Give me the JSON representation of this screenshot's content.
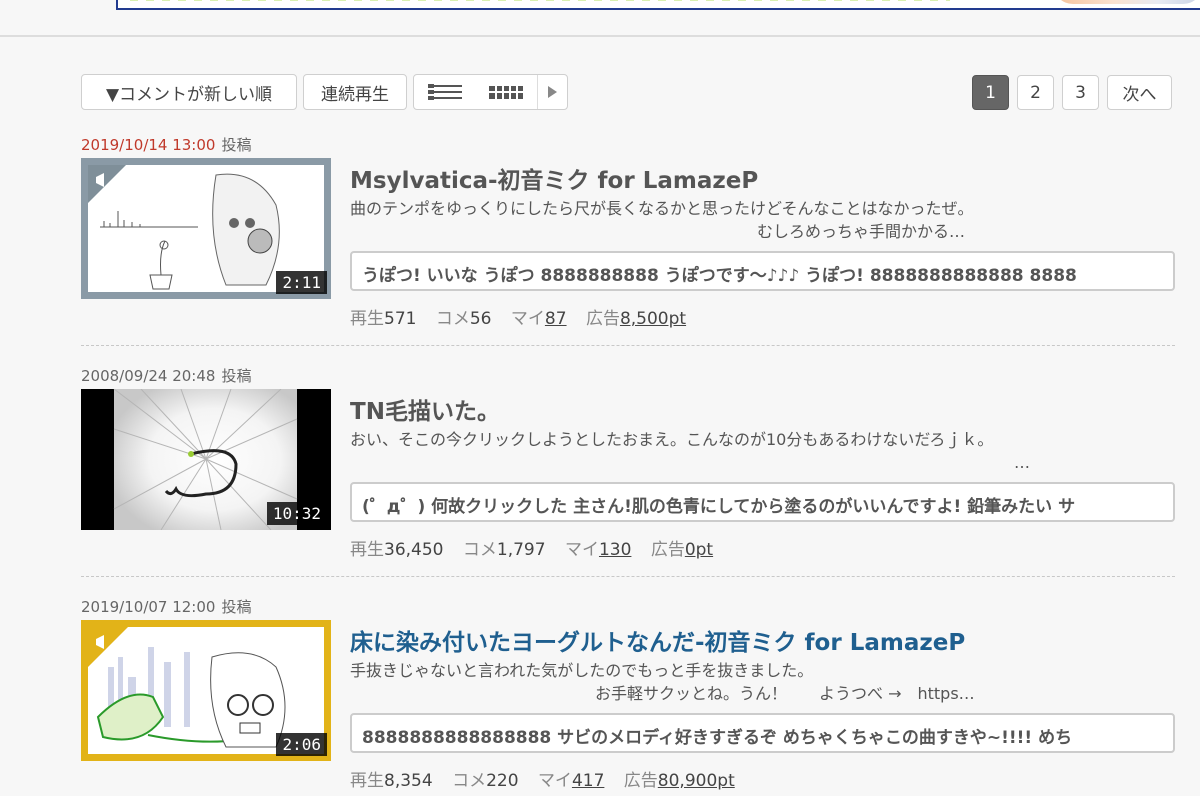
{
  "toolbar": {
    "sort_label": "▼コメントが新しい順",
    "continuous_label": "連続再生"
  },
  "pager": {
    "pages": [
      "1",
      "2",
      "3"
    ],
    "next_label": "次へ",
    "current": "1"
  },
  "labels": {
    "posted": "投稿",
    "plays": "再生",
    "comments": "コメ",
    "mylist": "マイ",
    "ads": "広告"
  },
  "videos": [
    {
      "date": "2019/10/14 13:00",
      "title": "Msylvatica-初音ミク for LamazeP",
      "desc_line1": "曲のテンポをゆっくりにしたら尺が長くなるかと思ったけどそんなことはなかったぜ。",
      "desc_line2": "むしろめっちゃ手間かかる…",
      "comment": "うぽつ! いいな うぽつ 8888888888 うぽつです～♪♪♪ うぽつ! 8888888888888 8888",
      "duration": "2:11",
      "plays": "571",
      "comments": "56",
      "mylist": "87",
      "ads": "8,500pt"
    },
    {
      "date": "2008/09/24 20:48",
      "title": "TN毛描いた。",
      "desc_line1": "おい、そこの今クリックしようとしたおまえ。こんなのが10分もあるわけないだろｊｋ。",
      "desc_line2": "…",
      "comment": "(゜д゜) 何故クリックした 主さん!肌の色青にしてから塗るのがいいんですよ! 鉛筆みたい サ",
      "duration": "10:32",
      "plays": "36,450",
      "comments": "1,797",
      "mylist": "130",
      "ads": "0pt"
    },
    {
      "date": "2019/10/07 12:00",
      "title": "床に染み付いたヨーグルトなんだ-初音ミク for LamazeP",
      "desc_line1": "手抜きじゃないと言われた気がしたのでもっと手を抜きました。",
      "desc_line2": "お手軽サクッとね。うん！　　ようつべ →　https…",
      "comment": "8888888888888888 サビのメロディ好きすぎるぞ めちゃくちゃこの曲すきや~!!!! めち",
      "duration": "2:06",
      "plays": "8,354",
      "comments": "220",
      "mylist": "417",
      "ads": "80,900pt"
    }
  ]
}
